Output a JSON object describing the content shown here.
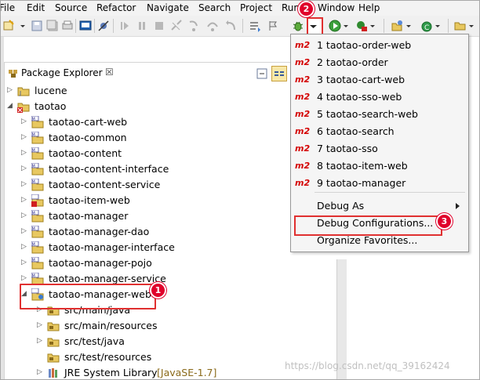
{
  "menubar": [
    "File",
    "Edit",
    "Source",
    "Refactor",
    "Navigate",
    "Search",
    "Project",
    "Run",
    "Window",
    "Help"
  ],
  "package_explorer": {
    "title": "Package Explorer",
    "close_glyph": "☒",
    "projects": [
      {
        "name": "lucene"
      },
      {
        "name": "taotao"
      },
      {
        "name": "taotao-cart-web"
      },
      {
        "name": "taotao-common"
      },
      {
        "name": "taotao-content"
      },
      {
        "name": "taotao-content-interface"
      },
      {
        "name": "taotao-content-service"
      },
      {
        "name": "taotao-item-web"
      },
      {
        "name": "taotao-manager"
      },
      {
        "name": "taotao-manager-dao"
      },
      {
        "name": "taotao-manager-interface"
      },
      {
        "name": "taotao-manager-pojo"
      },
      {
        "name": "taotao-manager-service"
      },
      {
        "name": "taotao-manager-web"
      },
      {
        "name": "src/main/java"
      },
      {
        "name": "src/main/resources"
      },
      {
        "name": "src/test/java"
      },
      {
        "name": "src/test/resources"
      },
      {
        "name": "JRE System Library",
        "suffix": "[JavaSE-1.7]"
      }
    ]
  },
  "debug_menu": {
    "items": [
      {
        "prefix": "m2",
        "label": "1 taotao-order-web"
      },
      {
        "prefix": "m2",
        "label": "2 taotao-order"
      },
      {
        "prefix": "m2",
        "label": "3 taotao-cart-web"
      },
      {
        "prefix": "m2",
        "label": "4 taotao-sso-web"
      },
      {
        "prefix": "m2",
        "label": "5 taotao-search-web"
      },
      {
        "prefix": "m2",
        "label": "6 taotao-search"
      },
      {
        "prefix": "m2",
        "label": "7 taotao-sso"
      },
      {
        "prefix": "m2",
        "label": "8 taotao-item-web"
      },
      {
        "prefix": "m2",
        "label": "9 taotao-manager"
      }
    ],
    "debug_as": "Debug As",
    "debug_configurations": "Debug Configurations...",
    "organize_favorites": "Organize Favorites..."
  },
  "badges": {
    "one": "1",
    "two": "2",
    "three": "3"
  },
  "colors": {
    "highlight_red": "#e03030",
    "badge_red": "#e0002b",
    "m2_red": "#d40000"
  },
  "watermark": "https://blog.csdn.net/qq_39162424"
}
